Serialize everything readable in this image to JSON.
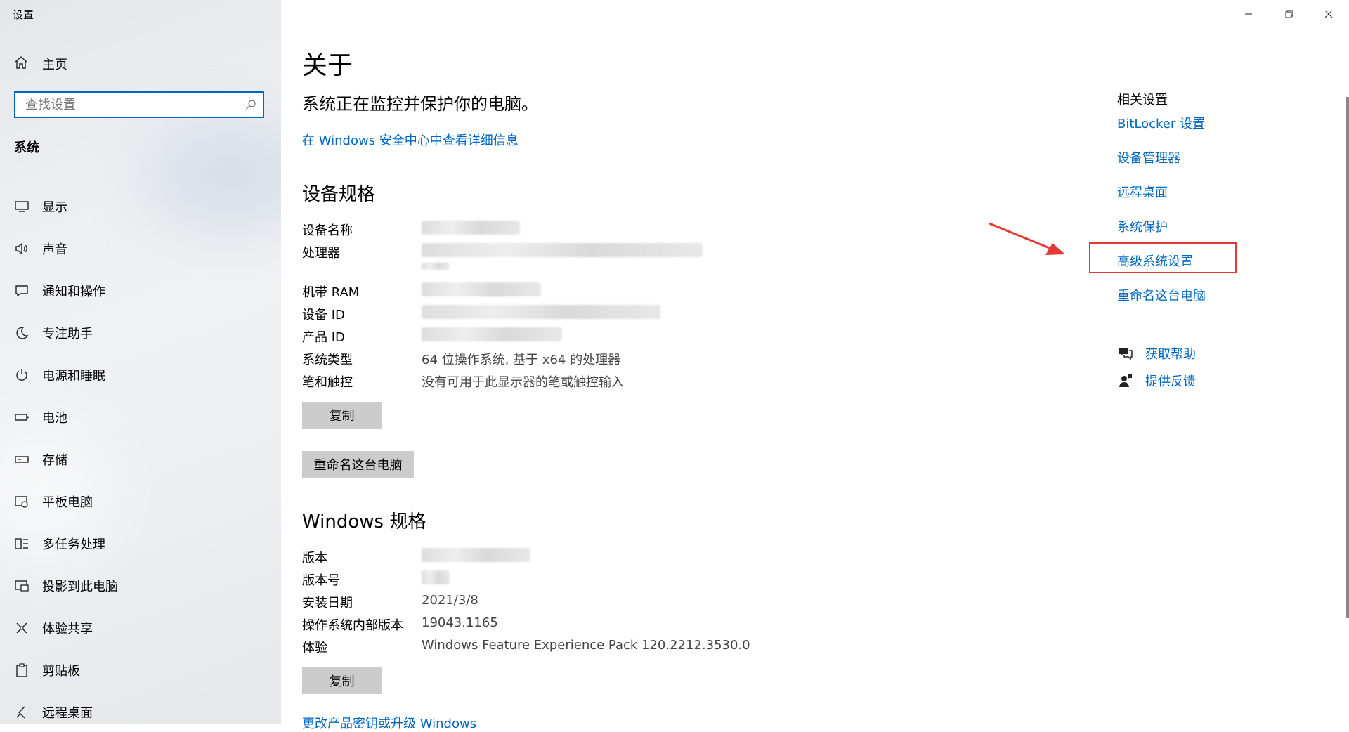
{
  "window": {
    "title": "设置"
  },
  "sidebar": {
    "home_label": "主页",
    "search_placeholder": "查找设置",
    "section": "系统",
    "items": [
      {
        "label": "显示",
        "icon": "monitor-icon"
      },
      {
        "label": "声音",
        "icon": "speaker-icon"
      },
      {
        "label": "通知和操作",
        "icon": "notification-icon"
      },
      {
        "label": "专注助手",
        "icon": "moon-icon"
      },
      {
        "label": "电源和睡眠",
        "icon": "power-icon"
      },
      {
        "label": "电池",
        "icon": "battery-icon"
      },
      {
        "label": "存储",
        "icon": "storage-icon"
      },
      {
        "label": "平板电脑",
        "icon": "tablet-icon"
      },
      {
        "label": "多任务处理",
        "icon": "multitask-icon"
      },
      {
        "label": "投影到此电脑",
        "icon": "project-icon"
      },
      {
        "label": "体验共享",
        "icon": "share-icon"
      },
      {
        "label": "剪贴板",
        "icon": "clipboard-icon"
      },
      {
        "label": "远程桌面",
        "icon": "remote-icon"
      }
    ]
  },
  "main": {
    "title": "关于",
    "status": "系统正在监控并保护你的电脑。",
    "security_link": "在 Windows 安全中心中查看详细信息",
    "device_specs": {
      "heading": "设备规格",
      "rows": [
        {
          "key": "设备名称",
          "value": ""
        },
        {
          "key": "处理器",
          "value": ""
        },
        {
          "key": "机带 RAM",
          "value": ""
        },
        {
          "key": "设备 ID",
          "value": ""
        },
        {
          "key": "产品 ID",
          "value": ""
        },
        {
          "key": "系统类型",
          "value": "64 位操作系统, 基于 x64 的处理器"
        },
        {
          "key": "笔和触控",
          "value": "没有可用于此显示器的笔或触控输入"
        }
      ],
      "copy_button": "复制",
      "rename_button": "重命名这台电脑"
    },
    "windows_specs": {
      "heading": "Windows 规格",
      "rows": [
        {
          "key": "版本",
          "value": ""
        },
        {
          "key": "版本号",
          "value": ""
        },
        {
          "key": "安装日期",
          "value": "2021/3/8"
        },
        {
          "key": "操作系统内部版本",
          "value": "19043.1165"
        },
        {
          "key": "体验",
          "value": "Windows Feature Experience Pack 120.2212.3530.0"
        }
      ],
      "copy_button": "复制"
    },
    "bottom_link": "更改产品密钥或升级 Windows"
  },
  "related": {
    "heading": "相关设置",
    "links": [
      "BitLocker 设置",
      "设备管理器",
      "远程桌面",
      "系统保护",
      "高级系统设置",
      "重命名这台电脑"
    ],
    "help": "获取帮助",
    "feedback": "提供反馈"
  },
  "colors": {
    "accent": "#0067c0",
    "highlight": "#e53935"
  }
}
